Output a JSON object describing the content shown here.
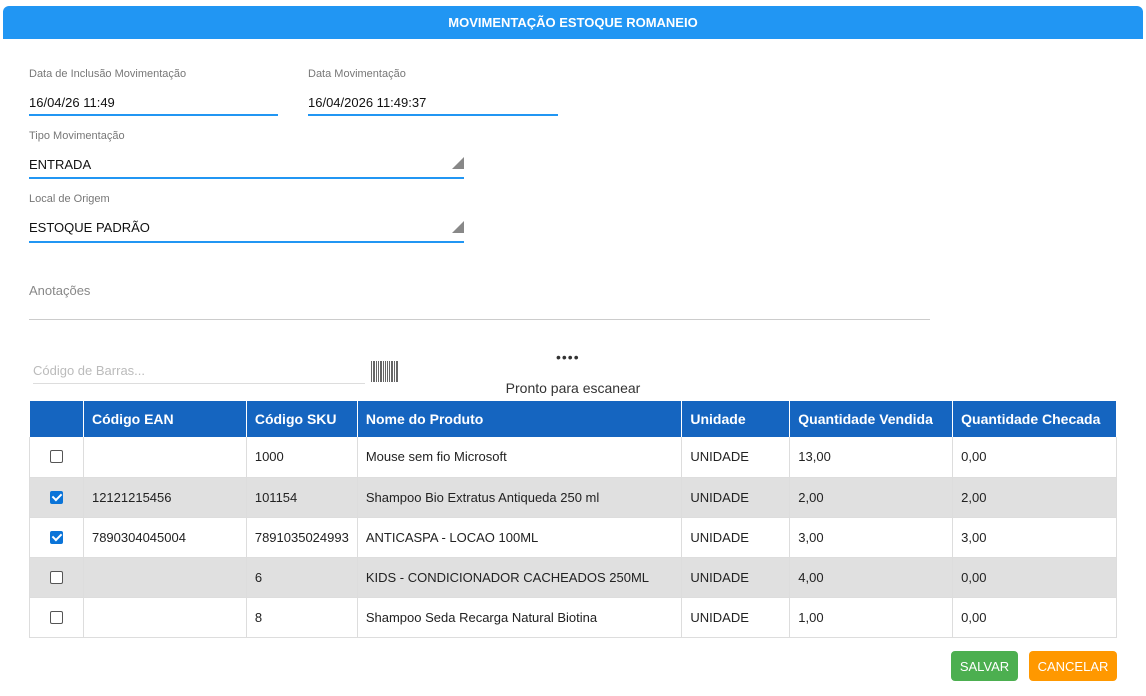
{
  "header": {
    "title": "MOVIMENTAÇÃO ESTOQUE ROMANEIO"
  },
  "fields": {
    "data_inclusao": {
      "label": "Data de Inclusão Movimentação",
      "value": "16/04/26 11:49"
    },
    "data_movimentacao": {
      "label": "Data Movimentação",
      "value": "16/04/2026 11:49:37"
    },
    "tipo_movimentacao": {
      "label": "Tipo Movimentação",
      "value": "ENTRADA"
    },
    "local_origem": {
      "label": "Local de Origem",
      "value": "ESTOQUE PADRÃO"
    },
    "anotacoes": {
      "label": "Anotações",
      "value": ""
    }
  },
  "scanner": {
    "placeholder": "Código de Barras...",
    "indicator": "••••",
    "status": "Pronto para escanear"
  },
  "table": {
    "columns": [
      "",
      "Código EAN",
      "Código SKU",
      "Nome do Produto",
      "Unidade",
      "Quantidade Vendida",
      "Quantidade Checada"
    ],
    "rows": [
      {
        "checked": false,
        "ean": "",
        "sku": "1000",
        "nome": "Mouse sem fio Microsoft",
        "unidade": "UNIDADE",
        "vendida": "13,00",
        "checada": "0,00"
      },
      {
        "checked": true,
        "ean": "12121215456",
        "sku": "101154",
        "nome": "Shampoo Bio Extratus Antiqueda 250 ml",
        "unidade": "UNIDADE",
        "vendida": "2,00",
        "checada": "2,00"
      },
      {
        "checked": true,
        "ean": "7890304045004",
        "sku": "7891035024993",
        "nome": "ANTICASPA - LOCAO 100ML",
        "unidade": "UNIDADE",
        "vendida": "3,00",
        "checada": "3,00"
      },
      {
        "checked": false,
        "ean": "",
        "sku": "6",
        "nome": "KIDS - CONDICIONADOR CACHEADOS 250ML",
        "unidade": "UNIDADE",
        "vendida": "4,00",
        "checada": "0,00"
      },
      {
        "checked": false,
        "ean": "",
        "sku": "8",
        "nome": "Shampoo Seda Recarga Natural Biotina",
        "unidade": "UNIDADE",
        "vendida": "1,00",
        "checada": "0,00"
      }
    ]
  },
  "actions": {
    "save": "SALVAR",
    "cancel": "CANCELAR"
  },
  "colors": {
    "primary": "#2196f3",
    "table_header": "#1565c0",
    "save": "#4caf50",
    "cancel": "#ff9800"
  }
}
